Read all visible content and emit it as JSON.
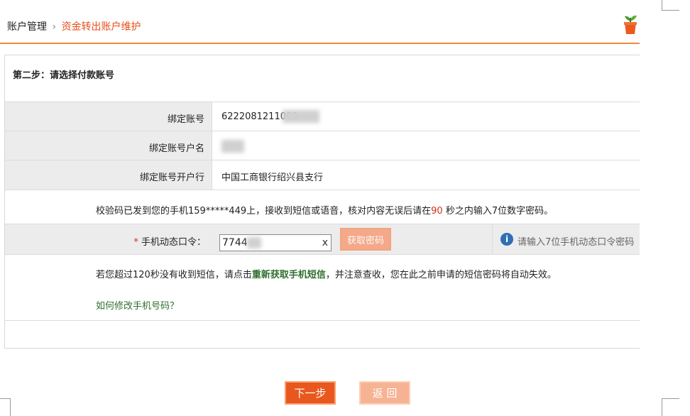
{
  "breadcrumb": {
    "root": "账户管理",
    "separator": "›",
    "current": "资金转出账户维护"
  },
  "step_title": "第二步：请选择付款账号",
  "fields": [
    {
      "label": "绑定账号",
      "value": "6222081211002"
    },
    {
      "label": "绑定账号户名",
      "value": ""
    },
    {
      "label": "绑定账号开户行",
      "value": "中国工商银行绍兴县支行"
    }
  ],
  "sms_notice": {
    "prefix": "校验码已发到您的手机159*****449上，接收到短信或语音，核对内容无误后请在",
    "seconds": "90",
    "suffix": "秒之内输入7位数字密码。"
  },
  "otp": {
    "required_mark": "*",
    "label": "手机动态口令：",
    "value": "7744",
    "clear": "x",
    "get_code_button": "获取密码",
    "hint": "请输入7位手机动态口令密码",
    "info_icon": "i"
  },
  "resend": {
    "prefix": "若您超过120秒没有收到短信，请点击",
    "link": "重新获取手机短信",
    "suffix": "，并注意查收，您在此之前申请的短信密码将自动失效。"
  },
  "change_phone_link": "如何修改手机号码？",
  "buttons": {
    "next": "下一步",
    "back": "返 回"
  },
  "colors": {
    "accent": "#e8501c",
    "rule": "#f08a3c",
    "link": "#2e6e2e"
  }
}
